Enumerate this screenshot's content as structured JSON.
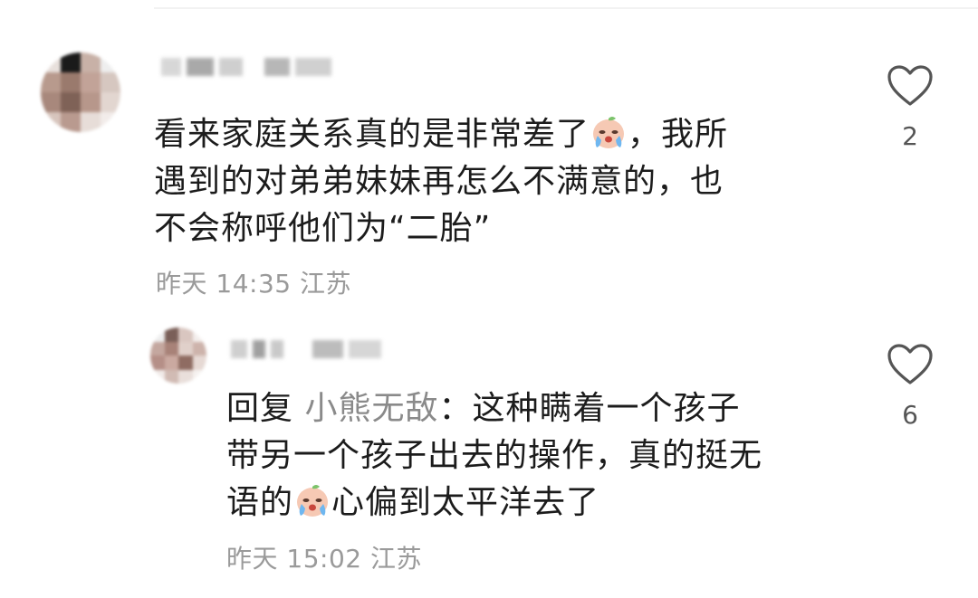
{
  "comments": [
    {
      "text_lines": [
        "看来家庭关系真的是非常差了",
        "，我所",
        "遇到的对弟弟妹妹再怎么不满意的，也",
        "不会称呼他们为“二胎”"
      ],
      "timestamp": "昨天 14:35",
      "location": "江苏",
      "likes": "2",
      "avatar_colors": [
        "#b99a8c",
        "#8b6d60",
        "#d8c3b8",
        "#a98377"
      ]
    },
    {
      "reply_prefix": "回复",
      "reply_to": "小熊无敌",
      "text_lines": [
        "：这种瞒着一个孩子",
        "带另一个孩子出去的操作，真的挺无",
        "语的",
        "心偏到太平洋去了"
      ],
      "timestamp": "昨天 15:02",
      "location": "江苏",
      "likes": "6",
      "avatar_colors": [
        "#caa9a0",
        "#7a5f58",
        "#e2cfca",
        "#b58f87"
      ]
    }
  ],
  "icons": {
    "like": "heart-outline-icon",
    "emoji": "crying-peach-emoji"
  }
}
